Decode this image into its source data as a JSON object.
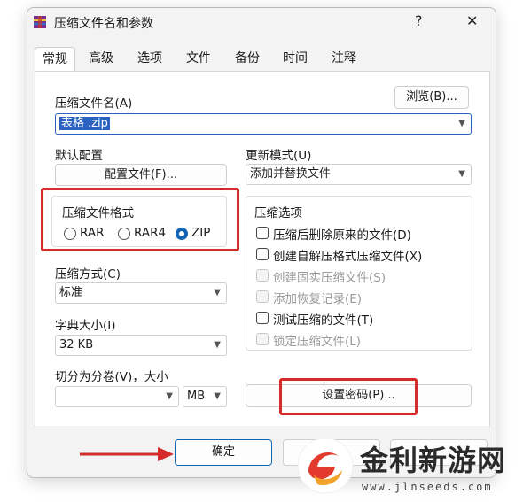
{
  "window": {
    "title": "压缩文件名和参数",
    "help_glyph": "?",
    "close_glyph": "✕"
  },
  "tabs": [
    {
      "label": "常规",
      "active": true
    },
    {
      "label": "高级",
      "active": false
    },
    {
      "label": "选项",
      "active": false
    },
    {
      "label": "文件",
      "active": false
    },
    {
      "label": "备份",
      "active": false
    },
    {
      "label": "时间",
      "active": false
    },
    {
      "label": "注释",
      "active": false
    }
  ],
  "archive_name": {
    "label": "压缩文件名(A)",
    "value_selected": "表格",
    "value_rest": ".zip",
    "browse_label": "浏览(B)..."
  },
  "profile": {
    "label": "默认配置",
    "button_label": "配置文件(F)..."
  },
  "update_mode": {
    "label": "更新模式(U)",
    "value": "添加并替换文件"
  },
  "format": {
    "label": "压缩文件格式",
    "options": [
      {
        "label": "RAR",
        "checked": false
      },
      {
        "label": "RAR4",
        "checked": false
      },
      {
        "label": "ZIP",
        "checked": true
      }
    ]
  },
  "method": {
    "label": "压缩方式(C)",
    "value": "标准"
  },
  "dict": {
    "label": "字典大小(I)",
    "value": "32 KB"
  },
  "split": {
    "label": "切分为分卷(V)，大小",
    "value": "",
    "unit": "MB"
  },
  "options": {
    "label": "压缩选项",
    "items": [
      {
        "label": "压缩后删除原来的文件(D)",
        "checked": false,
        "enabled": true
      },
      {
        "label": "创建自解压格式压缩文件(X)",
        "checked": false,
        "enabled": true
      },
      {
        "label": "创建固实压缩文件(S)",
        "checked": false,
        "enabled": false
      },
      {
        "label": "添加恢复记录(E)",
        "checked": false,
        "enabled": false
      },
      {
        "label": "测试压缩的文件(T)",
        "checked": false,
        "enabled": true
      },
      {
        "label": "锁定压缩文件(L)",
        "checked": false,
        "enabled": false
      }
    ]
  },
  "password_button": "设置密码(P)...",
  "footer": {
    "ok_label": "确定"
  },
  "watermark": {
    "brand": "金利新游网",
    "url": "www.jlnseeds.com"
  },
  "colors": {
    "accent": "#1464b4",
    "highlight": "#d42b2b",
    "selection": "#2b62c2"
  }
}
